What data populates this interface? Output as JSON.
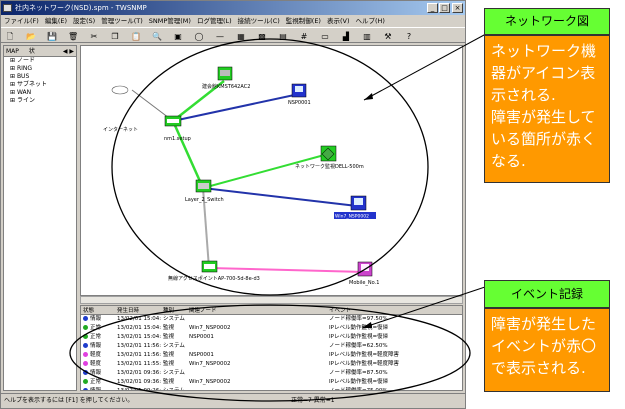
{
  "window": {
    "title": "社内ネットワーク(NSD).spm - TWSNMP",
    "min_label": "_",
    "max_label": "□",
    "close_label": "×"
  },
  "menu": [
    "ファイル(F)",
    "編集(E)",
    "設定(S)",
    "管理ツール(T)",
    "SNMP管理(M)",
    "ログ管理(L)",
    "接続ツール(C)",
    "監視制御(E)",
    "表示(V)",
    "ヘルプ(H)"
  ],
  "toolbar_icons": [
    "new-icon",
    "open-icon",
    "save-icon",
    "trash-icon",
    "cut-icon",
    "copy-icon",
    "paste-icon",
    "find-icon",
    "node-icon",
    "ring-icon",
    "line-icon",
    "group-icon",
    "image-icon",
    "table-icon",
    "grid-icon",
    "doc-icon",
    "chart-icon",
    "mib-icon",
    "tool-icon",
    "help-icon"
  ],
  "tree": {
    "tab_label": "MAP",
    "tab_label2": "状",
    "items": [
      "ノード",
      "RING",
      "BUS",
      "サブネット",
      "WAN",
      "ライン"
    ]
  },
  "map": {
    "nodes": [
      {
        "label": "建会館KMST642AC2"
      },
      {
        "label": "NSP0001"
      },
      {
        "label": "インターネット"
      },
      {
        "label": "nm1.setup"
      },
      {
        "label": "ネットワーク監視DELL-500m"
      },
      {
        "label": "Layer_2_Switch"
      },
      {
        "label": "Win7_NSP0002"
      },
      {
        "label": "無線アクセスポイントAP-700-5d-8e-d3"
      },
      {
        "label": "Mobile_No.1"
      }
    ]
  },
  "events": {
    "headers": [
      "状態",
      "発生日時",
      "種別",
      "関連ノード",
      "イベント"
    ],
    "rows": [
      {
        "state": "情報",
        "color": "#1e3ccc",
        "time": "13/02/01 15:04:43",
        "kind": "システム",
        "node": "",
        "event": "ノード稼働率=97.50%"
      },
      {
        "state": "正常",
        "color": "#22aa22",
        "time": "13/02/01 15:04:13",
        "kind": "監視",
        "node": "Win7_NSP0002",
        "event": "IPレベル動作監視=復帰"
      },
      {
        "state": "正常",
        "color": "#22aa22",
        "time": "13/02/01 15:04:05",
        "kind": "監視",
        "node": "NSP0001",
        "event": "IPレベル動作監視=復帰"
      },
      {
        "state": "情報",
        "color": "#1e3ccc",
        "time": "13/02/01 11:56:43",
        "kind": "システム",
        "node": "",
        "event": "ノード稼働率=62.50%"
      },
      {
        "state": "軽度",
        "color": "#e040e0",
        "time": "13/02/01 11:56:15",
        "kind": "監視",
        "node": "NSP0001",
        "event": "IPレベル動作監視=軽度障害"
      },
      {
        "state": "軽度",
        "color": "#e040e0",
        "time": "13/02/01 11:55:22",
        "kind": "監視",
        "node": "Win7_NSP0002",
        "event": "IPレベル動作監視=軽度障害"
      },
      {
        "state": "情報",
        "color": "#1e3ccc",
        "time": "13/02/01 09:36:43",
        "kind": "システム",
        "node": "",
        "event": "ノード稼働率=87.50%"
      },
      {
        "state": "正常",
        "color": "#22aa22",
        "time": "13/02/01 09:36:18",
        "kind": "監視",
        "node": "Win7_NSP0002",
        "event": "IPレベル動作監視=復帰"
      },
      {
        "state": "情報",
        "color": "#1e3ccc",
        "time": "13/02/01 09:26:43",
        "kind": "システム",
        "node": "",
        "event": "ノード稼働率=75.00%"
      }
    ]
  },
  "status": {
    "left": "ヘルプを表示するには [F1] を押してください。",
    "right": "正常=7 異常=1"
  },
  "callouts": {
    "network_title": "ネットワーク図",
    "network_body": [
      "ネットワーク機",
      "器がアイコン表",
      "示される.",
      "障害が発生して",
      "いる箇所が赤く",
      "なる."
    ],
    "event_title": "イベント記録",
    "event_body": [
      "障害が発生した",
      "イベントが赤〇",
      "で表示される."
    ]
  }
}
